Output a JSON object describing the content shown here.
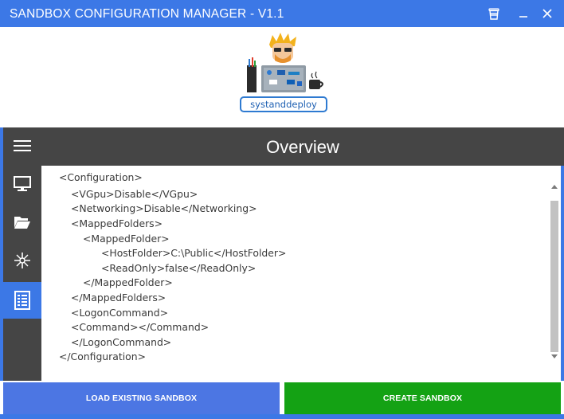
{
  "window": {
    "title": "SANDBOX CONFIGURATION MANAGER - V1.1",
    "minimize_icon": "minimize-icon",
    "close_icon": "close-icon",
    "coffee_icon": "coffee-cup-icon"
  },
  "logo": {
    "text": "systanddeploy"
  },
  "header": {
    "title": "Overview"
  },
  "sidebar": {
    "items": [
      {
        "icon": "menu-icon",
        "active": false
      },
      {
        "icon": "monitor-icon",
        "active": false
      },
      {
        "icon": "folder-open-icon",
        "active": false
      },
      {
        "icon": "sparkle-icon",
        "active": false
      },
      {
        "icon": "document-list-icon",
        "active": true
      }
    ]
  },
  "xml": {
    "lines": [
      "<Configuration>",
      "<VGpu>Disable</VGpu>",
      "<Networking>Disable</Networking>",
      "<MappedFolders>",
      "<MappedFolder>",
      "<HostFolder>C:\\Public</HostFolder>",
      "<ReadOnly>false</ReadOnly>",
      "</MappedFolder>",
      "</MappedFolders>",
      "<LogonCommand>",
      "<Command></Command>",
      "</LogonCommand>",
      "</Configuration>"
    ]
  },
  "buttons": {
    "load": "LOAD EXISTING SANDBOX",
    "create": "CREATE SANDBOX"
  },
  "colors": {
    "titlebar": "#3c78e6",
    "sidebar": "#454545",
    "active": "#3c78e6",
    "load_button": "#4c76e3",
    "create_button": "#14a214"
  }
}
